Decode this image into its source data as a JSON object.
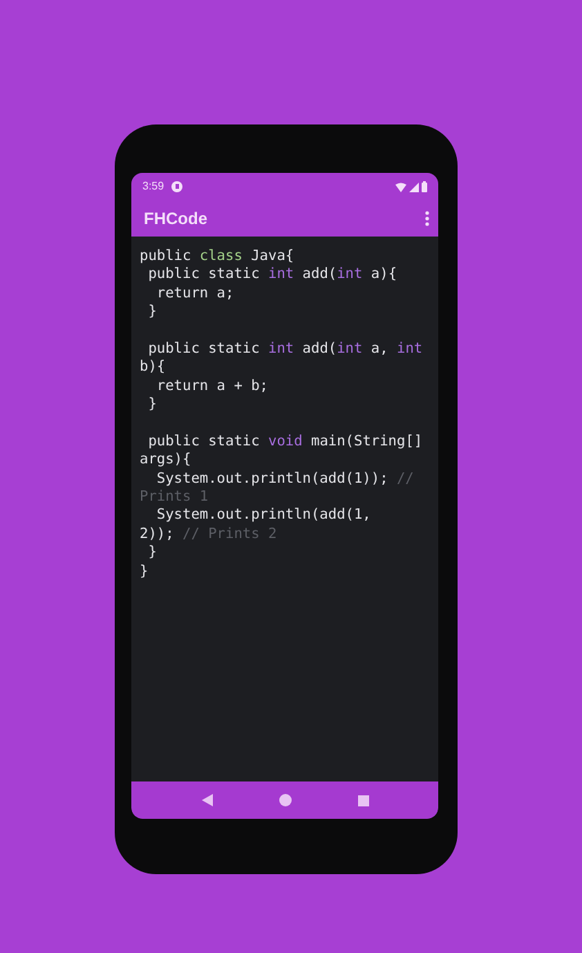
{
  "status_bar": {
    "time": "3:59"
  },
  "app_bar": {
    "title": "FHCode"
  },
  "code_lines": [
    [
      {
        "kind": "plain",
        "text": "public "
      },
      {
        "kind": "class",
        "text": "class"
      },
      {
        "kind": "plain",
        "text": " Java{"
      }
    ],
    [
      {
        "kind": "plain",
        "text": " public static "
      },
      {
        "kind": "type",
        "text": "int"
      },
      {
        "kind": "plain",
        "text": " add("
      },
      {
        "kind": "type",
        "text": "int"
      },
      {
        "kind": "plain",
        "text": " a){"
      }
    ],
    [
      {
        "kind": "plain",
        "text": "  return a;"
      }
    ],
    [
      {
        "kind": "plain",
        "text": " }"
      }
    ],
    [
      {
        "kind": "gap"
      },
      {
        "kind": "plain",
        "text": " public static "
      },
      {
        "kind": "type",
        "text": "int"
      },
      {
        "kind": "plain",
        "text": " add("
      },
      {
        "kind": "type",
        "text": "int"
      },
      {
        "kind": "plain",
        "text": " a, "
      },
      {
        "kind": "type",
        "text": "int"
      }
    ],
    [
      {
        "kind": "plain",
        "text": "b){"
      }
    ],
    [
      {
        "kind": "plain",
        "text": "  return a + b;"
      }
    ],
    [
      {
        "kind": "plain",
        "text": " }"
      }
    ],
    [
      {
        "kind": "gap"
      },
      {
        "kind": "plain",
        "text": " public static "
      },
      {
        "kind": "type",
        "text": "void"
      },
      {
        "kind": "plain",
        "text": " main(String[]"
      }
    ],
    [
      {
        "kind": "plain",
        "text": "args){"
      }
    ],
    [
      {
        "kind": "plain",
        "text": "  System.out.println(add(1)); "
      },
      {
        "kind": "comment",
        "text": "//"
      }
    ],
    [
      {
        "kind": "comment",
        "text": "Prints 1"
      }
    ],
    [
      {
        "kind": "plain",
        "text": "  System.out.println(add(1,"
      }
    ],
    [
      {
        "kind": "plain",
        "text": "2)); "
      },
      {
        "kind": "comment",
        "text": "// Prints 2"
      }
    ],
    [
      {
        "kind": "plain",
        "text": " }"
      }
    ],
    [
      {
        "kind": "plain",
        "text": "}"
      }
    ]
  ]
}
